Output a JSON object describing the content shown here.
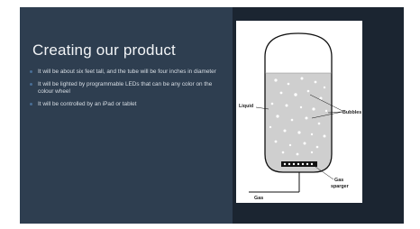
{
  "slide": {
    "title": "Creating our product",
    "bullets": [
      "It will be about six feet tall, and the tube will be four inches in diameter",
      "It will be lighted by programmable LEDs that can be any color on the colour wheel",
      "It will be controlled by an iPad or tablet"
    ]
  },
  "diagram": {
    "labels": {
      "liquid": "Liquid",
      "bubbles": "Bubbles",
      "gas_sparger_line1": "Gas",
      "gas_sparger_line2": "sparger",
      "gas": "Gas"
    }
  },
  "colors": {
    "left_panel": "#2e3e50",
    "right_panel": "#1b2531",
    "bullet_dot": "#4a6f96"
  }
}
